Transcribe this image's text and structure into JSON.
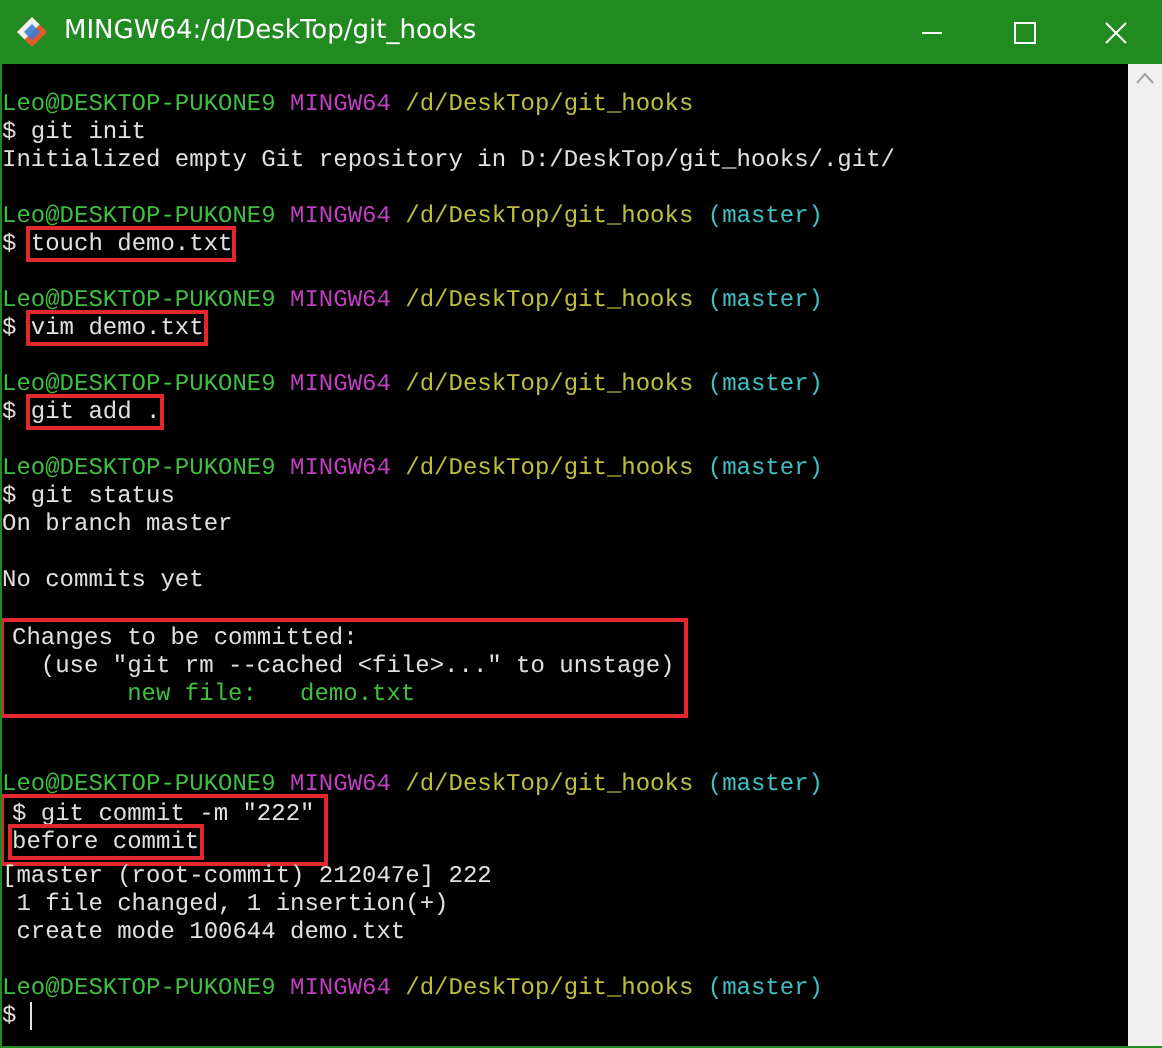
{
  "window": {
    "title": "MINGW64:/d/DeskTop/git_hooks"
  },
  "terminal": [
    {
      "kind": "line",
      "segments": [
        {
          "text": "Leo@DESKTOP-PUKONE9",
          "color": "#3fbf3f"
        },
        {
          "text": " MINGW64",
          "color": "#bf3fbf"
        },
        {
          "text": " /d/DeskTop/git_hooks",
          "color": "#bfbf3f"
        }
      ]
    },
    {
      "kind": "line",
      "segments": [
        {
          "text": "$ git init",
          "color": "#e0e0e0"
        }
      ]
    },
    {
      "kind": "line",
      "segments": [
        {
          "text": "Initialized empty Git repository in D:/DeskTop/git_hooks/.git/",
          "color": "#e0e0e0"
        }
      ]
    },
    {
      "kind": "blank"
    },
    {
      "kind": "line",
      "segments": [
        {
          "text": "Leo@DESKTOP-PUKONE9",
          "color": "#3fbf3f"
        },
        {
          "text": " MINGW64",
          "color": "#bf3fbf"
        },
        {
          "text": " /d/DeskTop/git_hooks",
          "color": "#bfbf3f"
        },
        {
          "text": " (master)",
          "color": "#3fbfbf"
        }
      ]
    },
    {
      "kind": "line",
      "segments": [
        {
          "text": "$ ",
          "color": "#e0e0e0"
        },
        {
          "text": "touch demo.txt",
          "color": "#e0e0e0",
          "boxed": true
        }
      ]
    },
    {
      "kind": "blank"
    },
    {
      "kind": "line",
      "segments": [
        {
          "text": "Leo@DESKTOP-PUKONE9",
          "color": "#3fbf3f"
        },
        {
          "text": " MINGW64",
          "color": "#bf3fbf"
        },
        {
          "text": " /d/DeskTop/git_hooks",
          "color": "#bfbf3f"
        },
        {
          "text": " (master)",
          "color": "#3fbfbf"
        }
      ]
    },
    {
      "kind": "line",
      "segments": [
        {
          "text": "$ ",
          "color": "#e0e0e0"
        },
        {
          "text": "vim demo.txt",
          "color": "#e0e0e0",
          "boxed": true
        }
      ]
    },
    {
      "kind": "blank"
    },
    {
      "kind": "line",
      "segments": [
        {
          "text": "Leo@DESKTOP-PUKONE9",
          "color": "#3fbf3f"
        },
        {
          "text": " MINGW64",
          "color": "#bf3fbf"
        },
        {
          "text": " /d/DeskTop/git_hooks",
          "color": "#bfbf3f"
        },
        {
          "text": " (master)",
          "color": "#3fbfbf"
        }
      ]
    },
    {
      "kind": "line",
      "segments": [
        {
          "text": "$ ",
          "color": "#e0e0e0"
        },
        {
          "text": "git add .",
          "color": "#e0e0e0",
          "boxed": true
        }
      ]
    },
    {
      "kind": "blank"
    },
    {
      "kind": "line",
      "segments": [
        {
          "text": "Leo@DESKTOP-PUKONE9",
          "color": "#3fbf3f"
        },
        {
          "text": " MINGW64",
          "color": "#bf3fbf"
        },
        {
          "text": " /d/DeskTop/git_hooks",
          "color": "#bfbf3f"
        },
        {
          "text": " (master)",
          "color": "#3fbfbf"
        }
      ]
    },
    {
      "kind": "line",
      "segments": [
        {
          "text": "$ git status",
          "color": "#e0e0e0"
        }
      ]
    },
    {
      "kind": "line",
      "segments": [
        {
          "text": "On branch master",
          "color": "#e0e0e0"
        }
      ]
    },
    {
      "kind": "blank"
    },
    {
      "kind": "line",
      "segments": [
        {
          "text": "No commits yet",
          "color": "#e0e0e0"
        }
      ]
    },
    {
      "kind": "blank"
    },
    {
      "kind": "box",
      "lines": [
        {
          "kind": "line",
          "segments": [
            {
              "text": "Changes to be committed:",
              "color": "#e0e0e0"
            }
          ]
        },
        {
          "kind": "line",
          "segments": [
            {
              "text": "  (use \"git rm --cached <file>...\" to unstage)",
              "color": "#e0e0e0"
            }
          ]
        },
        {
          "kind": "line",
          "segments": [
            {
              "text": "        new file:   demo.txt",
              "color": "#3fbf3f"
            }
          ]
        }
      ]
    },
    {
      "kind": "blank"
    },
    {
      "kind": "blank"
    },
    {
      "kind": "line",
      "segments": [
        {
          "text": "Leo@DESKTOP-PUKONE9",
          "color": "#3fbf3f"
        },
        {
          "text": " MINGW64",
          "color": "#bf3fbf"
        },
        {
          "text": " /d/DeskTop/git_hooks",
          "color": "#bfbf3f"
        },
        {
          "text": " (master)",
          "color": "#3fbfbf"
        }
      ]
    },
    {
      "kind": "box",
      "lines": [
        {
          "kind": "line",
          "segments": [
            {
              "text": "$ git commit -m \"222\"",
              "color": "#e0e0e0"
            }
          ]
        },
        {
          "kind": "line",
          "segments": [
            {
              "text": "before commit",
              "color": "#e0e0e0",
              "boxed": true
            }
          ]
        }
      ]
    },
    {
      "kind": "line",
      "segments": [
        {
          "text": "[master (root-commit) 212047e] 222",
          "color": "#e0e0e0"
        }
      ]
    },
    {
      "kind": "line",
      "segments": [
        {
          "text": " 1 file changed, 1 insertion(+)",
          "color": "#e0e0e0"
        }
      ]
    },
    {
      "kind": "line",
      "segments": [
        {
          "text": " create mode 100644 demo.txt",
          "color": "#e0e0e0"
        }
      ]
    },
    {
      "kind": "blank"
    },
    {
      "kind": "line",
      "segments": [
        {
          "text": "Leo@DESKTOP-PUKONE9",
          "color": "#3fbf3f"
        },
        {
          "text": " MINGW64",
          "color": "#bf3fbf"
        },
        {
          "text": " /d/DeskTop/git_hooks",
          "color": "#bfbf3f"
        },
        {
          "text": " (master)",
          "color": "#3fbfbf"
        }
      ]
    },
    {
      "kind": "line",
      "cursor": true,
      "segments": [
        {
          "text": "$ ",
          "color": "#e0e0e0"
        }
      ]
    }
  ]
}
